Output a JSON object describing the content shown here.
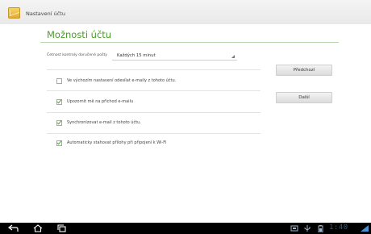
{
  "appbar": {
    "title": "Nastavení účtu"
  },
  "page": {
    "title": "Možnosti účtu"
  },
  "frequency": {
    "label": "Četnost kontroly doručené pošty",
    "value": "Každých 15 minut"
  },
  "options": [
    {
      "label": "Ve výchozím nastavení odesílat e-maily z tohoto účtu.",
      "checked": false
    },
    {
      "label": "Upozornit mě na příchod e-mailu",
      "checked": true
    },
    {
      "label": "Synchronizovat e-mail z tohoto účtu.",
      "checked": true
    },
    {
      "label": "Automaticky stahovat přílohy při připojení k Wi-Fi",
      "checked": true
    }
  ],
  "buttons": {
    "previous": "Předchozí",
    "next": "Další"
  },
  "statusbar": {
    "time": "1:40"
  },
  "icons": {
    "app": "account-icon",
    "nav": [
      "back-icon",
      "home-icon",
      "recent-apps-icon"
    ],
    "status": [
      "screenshot-icon",
      "usb-icon",
      "battery-icon",
      "wifi-icon"
    ]
  },
  "colors": {
    "accent": "#4a9a2e",
    "check": "#4ba82e",
    "clock": "#3a5470"
  }
}
